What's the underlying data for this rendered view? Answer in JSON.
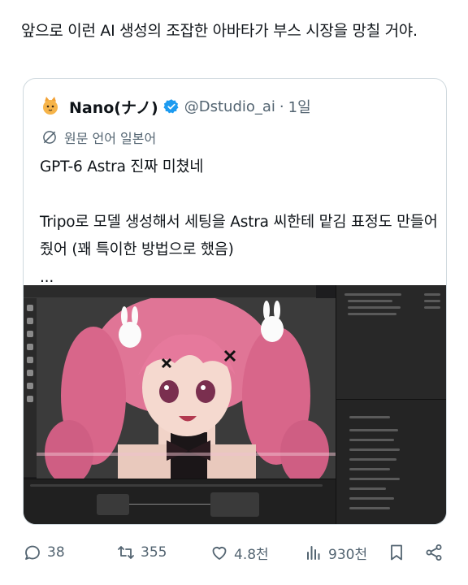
{
  "post": {
    "text": "앞으로 이런 AI 생성의 조잡한 아바타가 부스 시장을 망칠 거야."
  },
  "quote": {
    "author_name": "Nano(ナノ)",
    "handle": "@Dstudio_ai",
    "separator": "·",
    "time": "1일",
    "translate_label": "원문 언어 일본어",
    "body_line1": "GPT-6 Astra 진짜 미쳤네",
    "body_line2": "Tripo로 모델 생성해서 세팅을 Astra 씨한테 맡김 표정도 만들어줬어 (꽤 특이한 방법으로 했음)",
    "body_line3": "...",
    "avatar_icon": "cat-avatar-icon",
    "verified_icon": "verified-badge-icon",
    "translate_icon": "translate-icon"
  },
  "media": {
    "description_icon": "blender-screenshot-image"
  },
  "actions": {
    "reply_count": "38",
    "repost_count": "355",
    "like_count": "4.8천",
    "views_count": "930천",
    "reply_icon": "reply-icon",
    "repost_icon": "repost-icon",
    "like_icon": "heart-icon",
    "views_icon": "views-icon",
    "bookmark_icon": "bookmark-icon",
    "share_icon": "share-icon"
  },
  "colors": {
    "text": "#0f1419",
    "muted": "#536471",
    "verified": "#1d9bf0",
    "border": "#cfd9de",
    "hair": "#e8779f"
  }
}
